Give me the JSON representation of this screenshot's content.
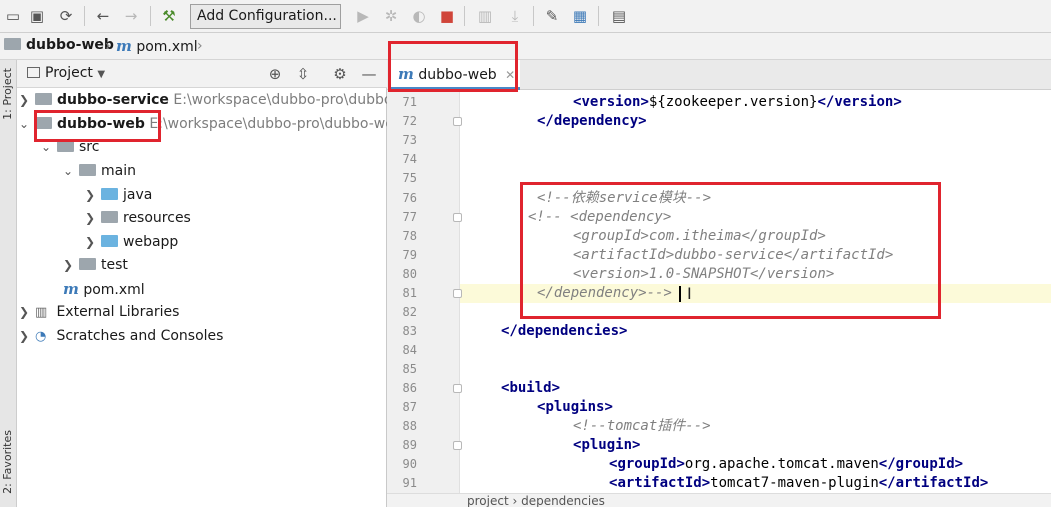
{
  "toolbar": {
    "run_config": "Add Configuration..."
  },
  "breadcrumb": {
    "project": "dubbo-web",
    "file": "pom.xml"
  },
  "left_strip": {
    "project_label": "1: Project",
    "favorites_label": "2: Favorites"
  },
  "project_panel": {
    "title": "Project",
    "tree": [
      {
        "label": "dubbo-service",
        "path": "E:\\workspace\\dubbo-pro\\dubbo-"
      },
      {
        "label": "dubbo-web",
        "path": "E:\\workspace\\dubbo-pro\\dubbo-we"
      },
      {
        "label": "src"
      },
      {
        "label": "main"
      },
      {
        "label": "java"
      },
      {
        "label": "resources"
      },
      {
        "label": "webapp"
      },
      {
        "label": "test"
      },
      {
        "label": "pom.xml"
      },
      {
        "label": "External Libraries"
      },
      {
        "label": "Scratches and Consoles"
      }
    ]
  },
  "editor": {
    "tab": "dubbo-web",
    "line_numbers": [
      "71",
      "72",
      "73",
      "74",
      "75",
      "76",
      "77",
      "78",
      "79",
      "80",
      "81",
      "82",
      "83",
      "84",
      "85",
      "86",
      "87",
      "88",
      "89",
      "90",
      "91"
    ],
    "lines": {
      "l71_text": "${zookeeper.version}",
      "l76": "<!--依赖service模块-->",
      "l77": "<!-- <dependency>",
      "l78": "<groupId>com.itheima</groupId>",
      "l79": "<artifactId>dubbo-service</artifactId>",
      "l80": "<version>1.0-SNAPSHOT</version>",
      "l81": "</dependency>-->",
      "l88": "<!--tomcat插件-->",
      "l90_text": "org.apache.tomcat.maven",
      "l91_text": "tomcat7-maven-plugin"
    },
    "tags": {
      "version": "version",
      "dependency": "dependency",
      "dependencies": "dependencies",
      "build": "build",
      "plugins": "plugins",
      "plugin": "plugin",
      "groupId": "groupId",
      "artifactId": "artifactId"
    },
    "status_crumb": "project  ›  dependencies"
  }
}
